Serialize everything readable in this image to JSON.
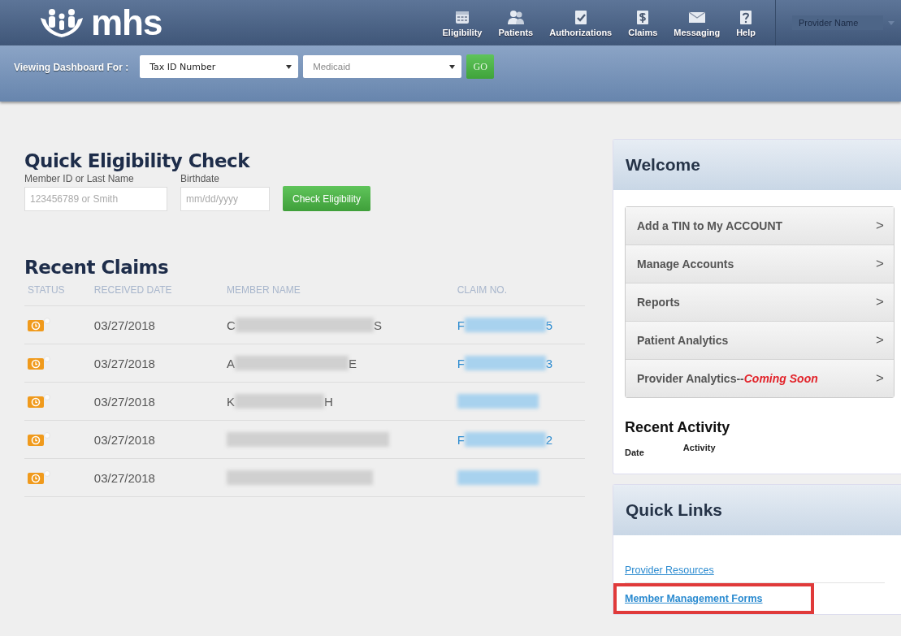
{
  "header": {
    "logo": "mhs",
    "nav": [
      {
        "label": "Eligibility"
      },
      {
        "label": "Patients"
      },
      {
        "label": "Authorizations"
      },
      {
        "label": "Claims"
      },
      {
        "label": "Messaging"
      },
      {
        "label": "Help"
      }
    ],
    "provider_select": "Provider Name"
  },
  "dashboard_bar": {
    "label": "Viewing Dashboard For :",
    "selects": [
      {
        "value": "Tax ID Number"
      },
      {
        "value": "Medicaid"
      }
    ],
    "go_button": "GO"
  },
  "eligibility": {
    "title": "Quick Eligibility Check",
    "fields": [
      {
        "label": "Member ID or Last Name",
        "placeholder": "123456789 or Smith"
      },
      {
        "label": "Birthdate",
        "placeholder": "mm/dd/yyyy"
      }
    ],
    "button": "Check Eligibility"
  },
  "recent_claims": {
    "title": "Recent Claims",
    "columns": [
      "STATUS",
      "RECEIVED DATE",
      "MEMBER NAME",
      "CLAIM NO."
    ],
    "rows": [
      {
        "date": "03/27/2018",
        "name_start": "C",
        "name_end": "S",
        "claim_start": "F",
        "claim_end": "5"
      },
      {
        "date": "03/27/2018",
        "name_start": "A",
        "name_end": "E",
        "claim_start": "F",
        "claim_end": "3"
      },
      {
        "date": "03/27/2018",
        "name_start": "K",
        "name_end": "H"
      },
      {
        "date": "03/27/2018",
        "claim_start": "F",
        "claim_end": "2"
      },
      {
        "date": "03/27/2018"
      }
    ]
  },
  "welcome": {
    "title": "Welcome",
    "items": [
      {
        "label": "Add a TIN to My ACCOUNT",
        "arrow": ">"
      },
      {
        "label": "Manage Accounts",
        "arrow": ">"
      },
      {
        "label": "Reports",
        "arrow": ">"
      },
      {
        "label": "Patient Analytics",
        "arrow": ">"
      },
      {
        "label": "Provider Analytics--",
        "note": "Coming Soon",
        "arrow": ">"
      }
    ],
    "recent_activity": {
      "title": "Recent Activity",
      "columns": [
        "Date",
        "Activity"
      ]
    }
  },
  "quick_links": {
    "title": "Quick Links",
    "links": [
      {
        "label": "Provider Resources",
        "highlighted": false
      },
      {
        "label": "Member Management Forms",
        "highlighted": true
      }
    ]
  }
}
